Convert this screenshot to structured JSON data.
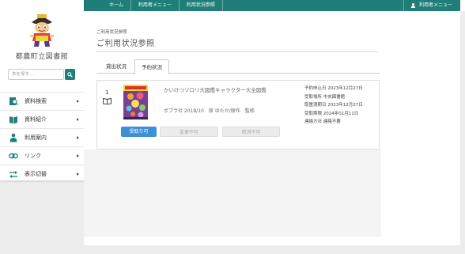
{
  "topnav": {
    "items": [
      "ホーム",
      "利用者メニュー",
      "利用状況参照"
    ],
    "user_menu": "利用者メニュー"
  },
  "sidebar": {
    "library_name": "都農町立図書館",
    "search_placeholder": "本を探す…",
    "menu": [
      {
        "label": "資料検索",
        "icon": "search-book-icon"
      },
      {
        "label": "資料紹介",
        "icon": "book-open-icon"
      },
      {
        "label": "利用案内",
        "icon": "person-guide-icon"
      },
      {
        "label": "リンク",
        "icon": "link-icon"
      },
      {
        "label": "表示切替",
        "icon": "switch-arrows-icon"
      }
    ]
  },
  "main": {
    "breadcrumb": "ご利用状況参照",
    "title": "ご利用状況参照",
    "tabs": [
      "貸出状況",
      "予約状況"
    ],
    "reservation": {
      "number": "1",
      "title": "かいけつゾロリ大図鑑キャラクター大全図鑑",
      "publisher": "ポプラ社 2018/10　原 ゆたか/原作　監修",
      "details": [
        "予約申込日 2023年12月27日",
        "受取場所 中央図書館",
        "取置満期日 2023年12月27日",
        "受取期限 2024年01月11日",
        "連絡方法 連絡不要"
      ],
      "buttons": {
        "receive": "受取り可",
        "change": "変更不可",
        "cancel": "取消不可"
      }
    }
  },
  "colors": {
    "accent": "#1f7f78",
    "button_blue": "#3d8fd8"
  }
}
